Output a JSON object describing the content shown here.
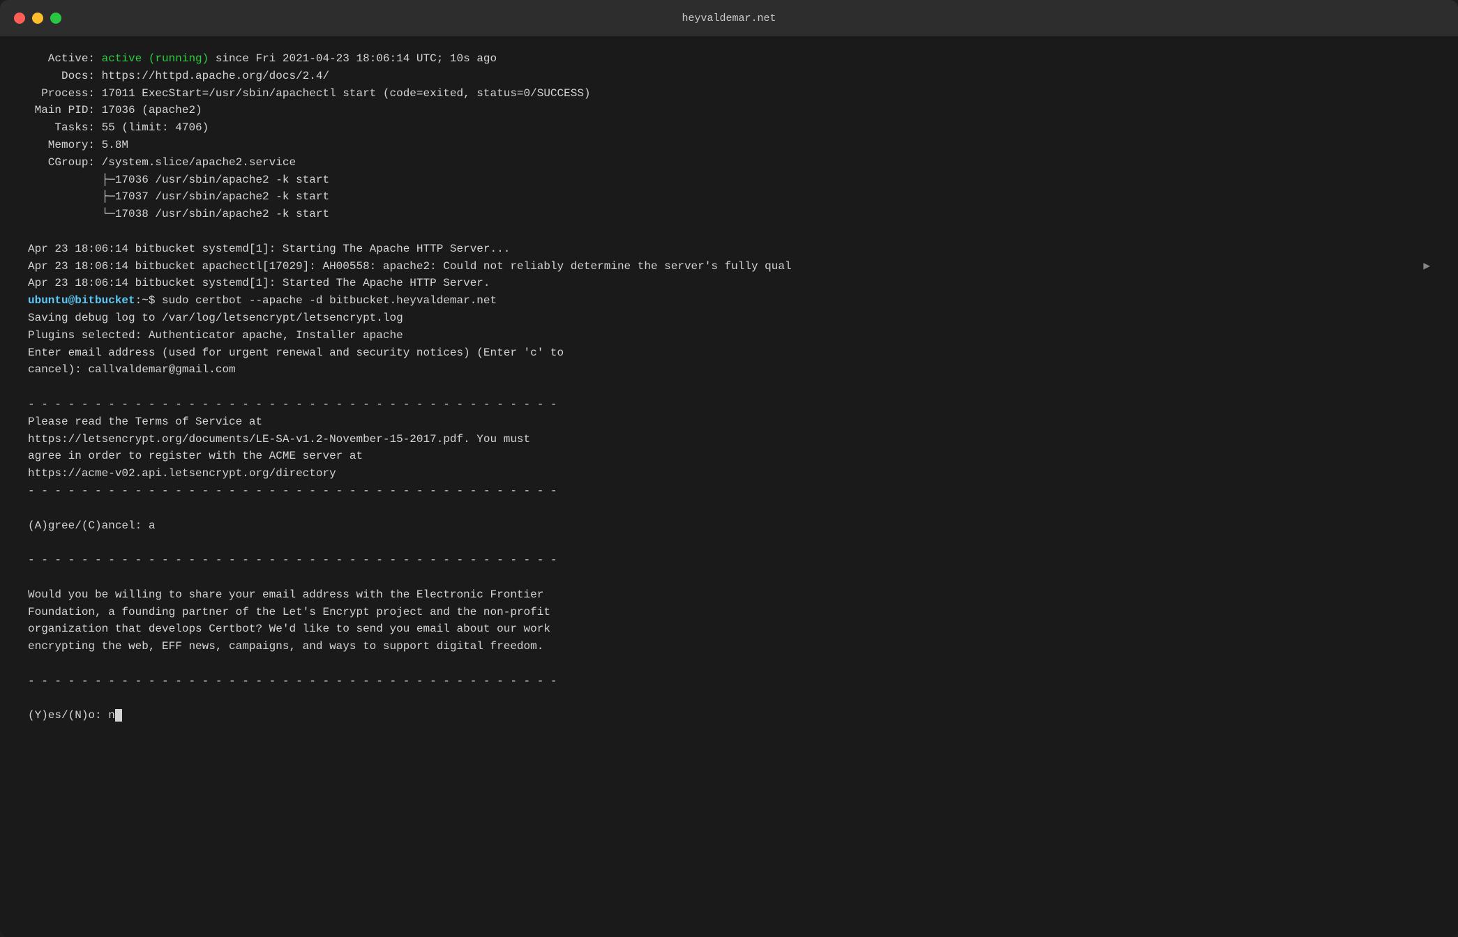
{
  "window": {
    "title": "heyvaldemar.net",
    "traffic_lights": {
      "close_label": "close",
      "minimize_label": "minimize",
      "maximize_label": "maximize"
    }
  },
  "terminal": {
    "lines": [
      {
        "type": "status",
        "text": "   Active: active (running) since Fri 2021-04-23 18:06:14 UTC; 10s ago"
      },
      {
        "type": "plain",
        "text": "     Docs: https://httpd.apache.org/docs/2.4/"
      },
      {
        "type": "plain",
        "text": "  Process: 17011 ExecStart=/usr/sbin/apachectl start (code=exited, status=0/SUCCESS)"
      },
      {
        "type": "plain",
        "text": " Main PID: 17036 (apache2)"
      },
      {
        "type": "plain",
        "text": "    Tasks: 55 (limit: 4706)"
      },
      {
        "type": "plain",
        "text": "   Memory: 5.8M"
      },
      {
        "type": "plain",
        "text": "   CGroup: /system.slice/apache2.service"
      },
      {
        "type": "plain",
        "text": "           ├─17036 /usr/sbin/apache2 -k start"
      },
      {
        "type": "plain",
        "text": "           ├─17037 /usr/sbin/apache2 -k start"
      },
      {
        "type": "plain",
        "text": "           └─17038 /usr/sbin/apache2 -k start"
      },
      {
        "type": "blank"
      },
      {
        "type": "plain",
        "text": "Apr 23 18:06:14 bitbucket systemd[1]: Starting The Apache HTTP Server..."
      },
      {
        "type": "truncated",
        "text": "Apr 23 18:06:14 bitbucket apachectl[17029]: AH00558: apache2: Could not reliably determine the server's fully qual"
      },
      {
        "type": "plain",
        "text": "Apr 23 18:06:14 bitbucket systemd[1]: Started The Apache HTTP Server."
      },
      {
        "type": "prompt",
        "text": "sudo certbot --apache -d bitbucket.heyvaldemar.net"
      },
      {
        "type": "plain",
        "text": "Saving debug log to /var/log/letsencrypt/letsencrypt.log"
      },
      {
        "type": "plain",
        "text": "Plugins selected: Authenticator apache, Installer apache"
      },
      {
        "type": "plain",
        "text": "Enter email address (used for urgent renewal and security notices) (Enter 'c' to"
      },
      {
        "type": "plain",
        "text": "cancel): callvaldemar@gmail.com"
      },
      {
        "type": "blank"
      },
      {
        "type": "dashes",
        "text": "- - - - - - - - - - - - - - - - - - - - - - - - - - - - - - - - - - - - - - - -"
      },
      {
        "type": "plain",
        "text": "Please read the Terms of Service at"
      },
      {
        "type": "plain",
        "text": "https://letsencrypt.org/documents/LE-SA-v1.2-November-15-2017.pdf. You must"
      },
      {
        "type": "plain",
        "text": "agree in order to register with the ACME server at"
      },
      {
        "type": "plain",
        "text": "https://acme-v02.api.letsencrypt.org/directory"
      },
      {
        "type": "dashes",
        "text": "- - - - - - - - - - - - - - - - - - - - - - - - - - - - - - - - - - - - - - - -"
      },
      {
        "type": "blank"
      },
      {
        "type": "plain",
        "text": "(A)gree/(C)ancel: a"
      },
      {
        "type": "blank"
      },
      {
        "type": "dashes",
        "text": "- - - - - - - - - - - - - - - - - - - - - - - - - - - - - - - - - - - - - - - -"
      },
      {
        "type": "blank"
      },
      {
        "type": "plain",
        "text": "Would you be willing to share your email address with the Electronic Frontier"
      },
      {
        "type": "plain",
        "text": "Foundation, a founding partner of the Let's Encrypt project and the non-profit"
      },
      {
        "type": "plain",
        "text": "organization that develops Certbot? We'd like to send you email about our work"
      },
      {
        "type": "plain",
        "text": "encrypting the web, EFF news, campaigns, and ways to support digital freedom."
      },
      {
        "type": "blank"
      },
      {
        "type": "dashes",
        "text": "- - - - - - - - - - - - - - - - - - - - - - - - - - - - - - - - - - - - - - - -"
      },
      {
        "type": "blank"
      },
      {
        "type": "input_line",
        "text": "(Y)es/(N)o: n"
      }
    ],
    "prompt_user": "ubuntu",
    "prompt_host": "bitbucket",
    "prompt_path": "~"
  }
}
